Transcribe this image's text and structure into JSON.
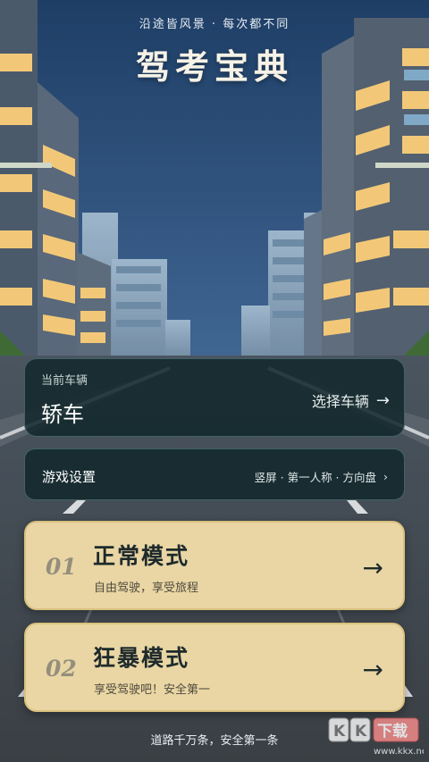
{
  "header": {
    "tagline": "沿途皆风景 · 每次都不同",
    "title": "驾考宝典"
  },
  "vehicle": {
    "label": "当前车辆",
    "current": "轿车",
    "select_label": "选择车辆",
    "arrow": "→"
  },
  "settings": {
    "label": "游戏设置",
    "value": "竖屏 · 第一人称 · 方向盘",
    "chevron": "›"
  },
  "modes": [
    {
      "number": "01",
      "title": "正常模式",
      "desc": "自由驾驶，享受旅程",
      "arrow": "→"
    },
    {
      "number": "02",
      "title": "狂暴模式",
      "desc": "享受驾驶吧！安全第一",
      "arrow": "→"
    }
  ],
  "footer": {
    "text": "道路千万条，安全第一条"
  },
  "watermark": {
    "text": "KK下载",
    "url": "www.kkx.net"
  },
  "colors": {
    "mode_card": "#e9d6a4",
    "dark_card": "#12282c",
    "sky_top": "#1e3e66",
    "sky_bottom": "#6c8eab"
  }
}
